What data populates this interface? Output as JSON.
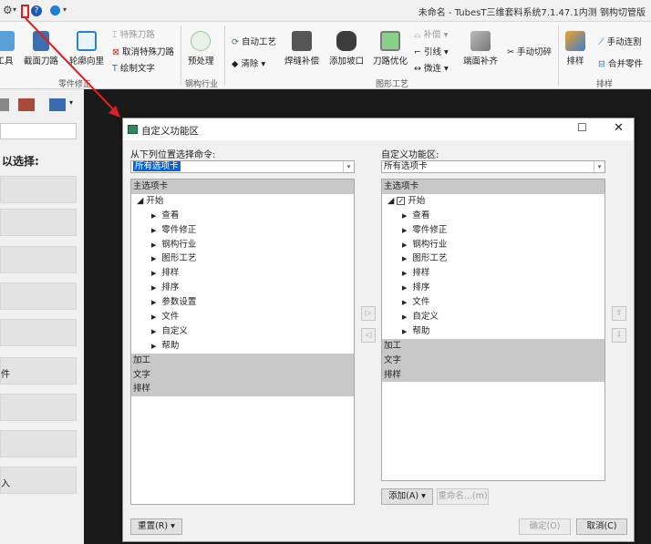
{
  "window": {
    "title": "未命名 - TubesT三维套料系统7.1.47.1内测 钢构切管版"
  },
  "ribbon": {
    "buttons": {
      "tool": "工具",
      "section_path": "截面刀路",
      "contour_inward": "轮廓向里",
      "preprocess": "预处理",
      "weld_compensate": "焊缝补偿",
      "add_notch": "添加坡口",
      "path_optimize": "刀路优化",
      "end_compensate": "端面补齐",
      "manual_cut": "手动切碎",
      "nesting": "排样"
    },
    "small": {
      "special_path": "特殊刀路",
      "cancel_special_path": "取消特殊刀路",
      "draw_text": "绘制文字",
      "auto_process": "自动工艺",
      "clear": "清除",
      "compensate": "补偿",
      "lead_line": "引线",
      "micro_joint": "微连",
      "manual_bridge": "手动连割",
      "merge_parts": "合并零件"
    },
    "groups": {
      "part_modify": "零件修正",
      "steel_industry": "钢构行业",
      "graphic_process": "图形工艺",
      "nesting": "排样"
    }
  },
  "left_panel": {
    "select_label": "以选择:",
    "items": [
      "",
      "",
      "",
      "",
      "",
      "件",
      "",
      "",
      "入"
    ]
  },
  "dialog": {
    "title": "自定义功能区",
    "left_label": "从下列位置选择命令:",
    "left_combo": "所有选项卡",
    "right_label": "自定义功能区:",
    "right_combo": "所有选项卡",
    "left_tree": {
      "main_header": "主选项卡",
      "root": "开始",
      "children": [
        "查看",
        "零件修正",
        "钢构行业",
        "图形工艺",
        "排样",
        "排序",
        "参数设置",
        "文件",
        "自定义",
        "帮助"
      ],
      "other_headers": [
        "加工",
        "文字",
        "排样"
      ]
    },
    "right_tree": {
      "main_header": "主选项卡",
      "root": "开始",
      "children": [
        "查看",
        "零件修正",
        "钢构行业",
        "图形工艺",
        "排样",
        "排序",
        "文件",
        "自定义",
        "帮助"
      ],
      "other_headers": [
        "加工",
        "文字",
        "排样"
      ]
    },
    "buttons": {
      "add": "添加(A) ▾",
      "rename": "重命名...(m)",
      "reset": "重置(R) ▾",
      "ok": "确定(O)",
      "cancel": "取消(C)"
    }
  },
  "colors": {
    "dialog_bg": "#f0f0f0",
    "tree_header": "#c8c8c8",
    "combo_selected": "#0a64d6",
    "annotation_red": "#e02020"
  }
}
